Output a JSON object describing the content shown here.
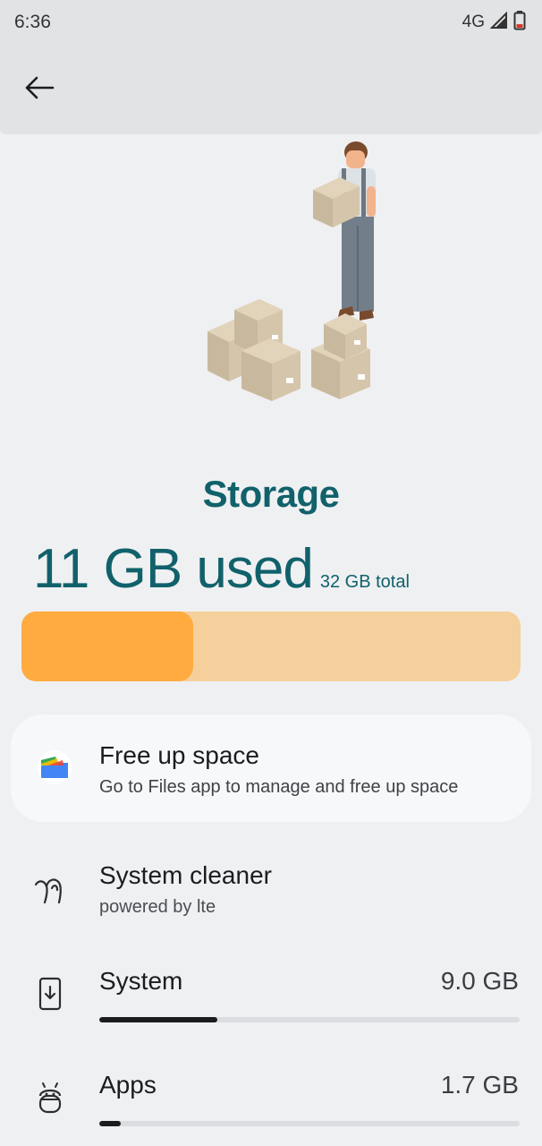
{
  "status_bar": {
    "time": "6:36",
    "network": "4G",
    "icons": [
      "signal-icon",
      "battery-low-icon"
    ]
  },
  "app_bar": {
    "back_icon": "arrow-left-icon"
  },
  "header": {
    "title": "Storage",
    "used": "11 GB used",
    "total": "32 GB total",
    "used_fraction": 0.344
  },
  "free_up": {
    "icon": "files-app-icon",
    "title": "Free up space",
    "subtitle": "Go to Files app to manage and free up space"
  },
  "items": [
    {
      "icon": "system-cleaner-icon",
      "title": "System cleaner",
      "subtitle": "powered by lte"
    },
    {
      "icon": "system-update-icon",
      "title": "System",
      "size": "9.0 GB",
      "fraction": 0.28
    },
    {
      "icon": "android-icon",
      "title": "Apps",
      "size": "1.7 GB",
      "fraction": 0.05
    }
  ],
  "colors": {
    "accent": "#11616b",
    "bar_fill": "#ffab40",
    "bar_track": "#f5d09c"
  }
}
